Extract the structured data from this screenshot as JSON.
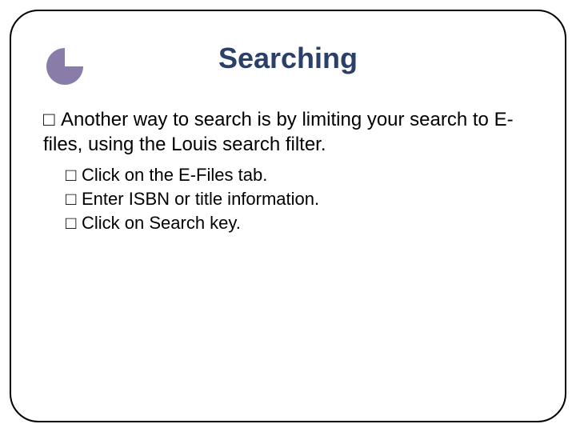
{
  "title": "Searching",
  "main_bullet": "Another way to search is by limiting your search to E-files, using the Louis search filter.",
  "sub_bullets": {
    "0": "Click on the E-Files tab.",
    "1": "Enter ISBN or title information.",
    "2": "Click on Search key."
  },
  "bullet_glyph": "□",
  "icon_color": "#8a7ca8"
}
